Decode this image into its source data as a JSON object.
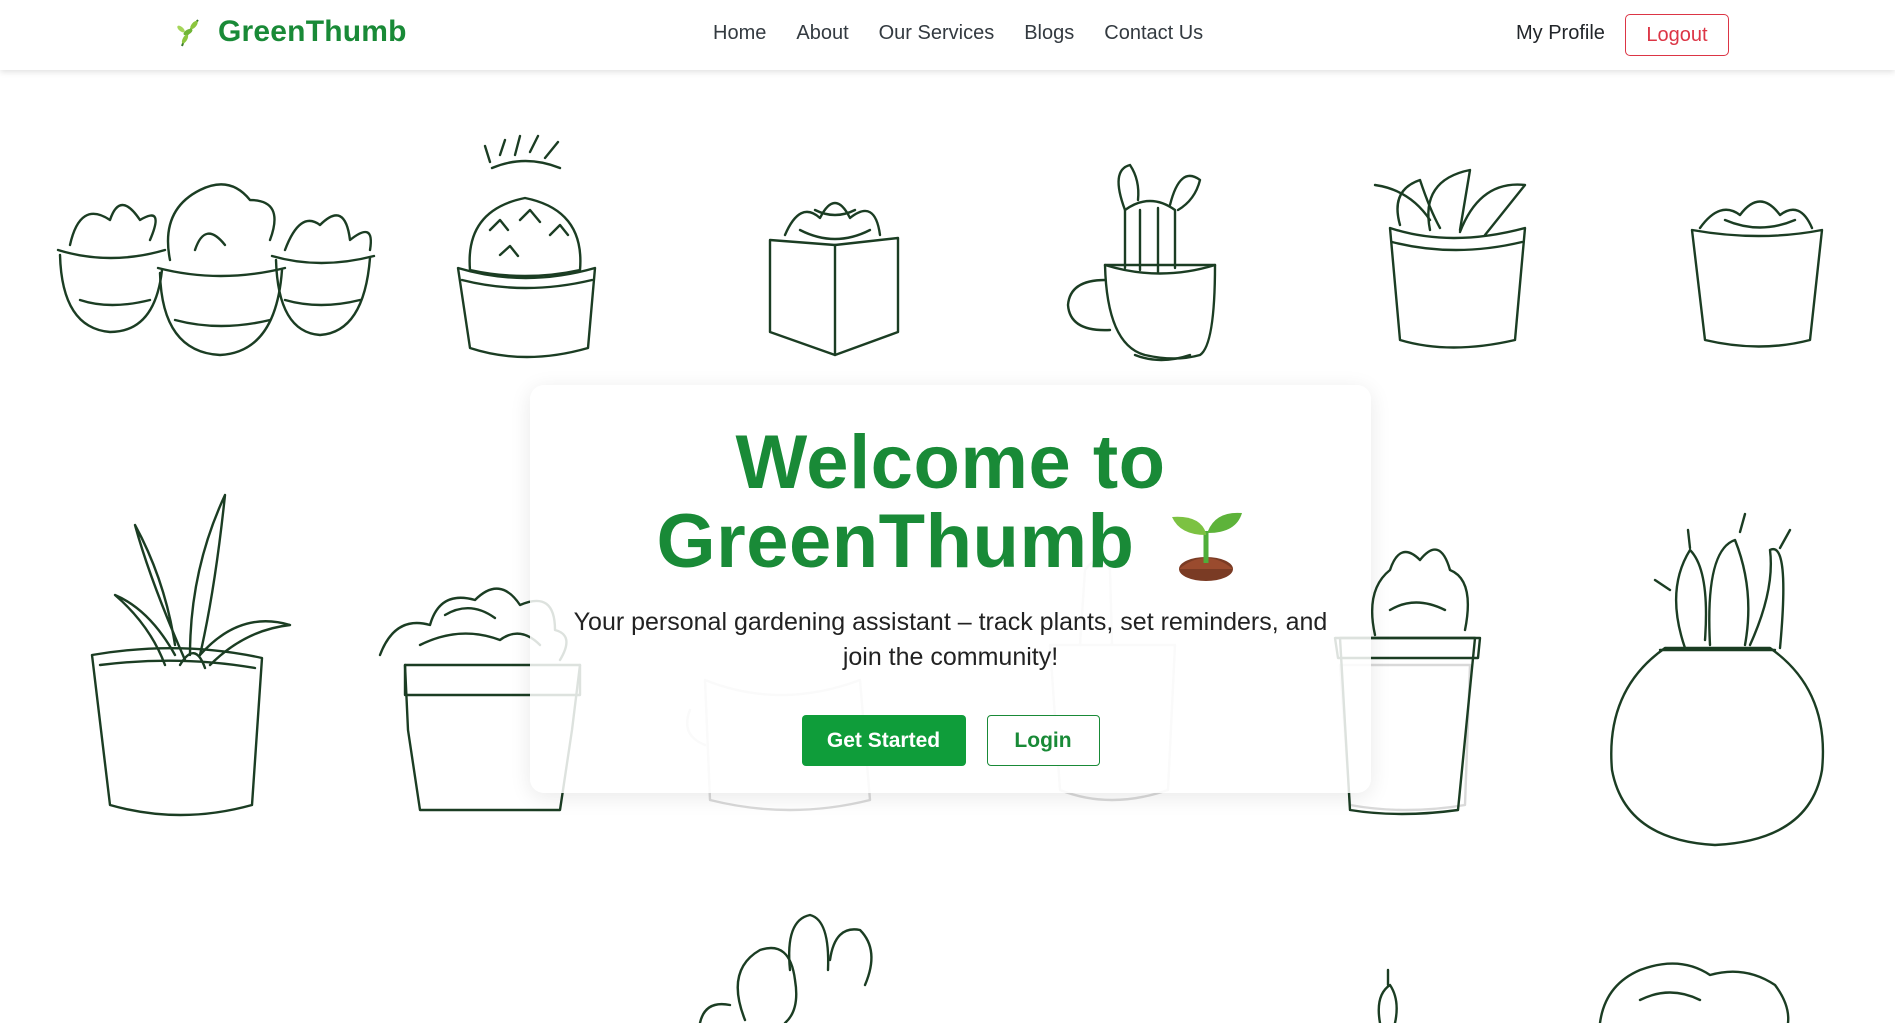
{
  "brand": {
    "name": "GreenThumb",
    "icon": "leaf-sprig-icon",
    "color": "#198a37"
  },
  "nav": {
    "links": [
      "Home",
      "About",
      "Our Services",
      "Blogs",
      "Contact Us"
    ],
    "profile_label": "My Profile",
    "logout_label": "Logout"
  },
  "hero": {
    "title_line1": "Welcome to",
    "title_line2": "GreenThumb",
    "title_icon": "seedling-icon",
    "subtitle": "Your personal gardening assistant – track plants, set reminders, and join the community!",
    "primary_button": "Get Started",
    "secondary_button": "Login"
  },
  "colors": {
    "accent": "#198a37",
    "primary_button": "#0f9d3a",
    "logout": "#dc3545",
    "plant_line": "#1b3d23"
  }
}
